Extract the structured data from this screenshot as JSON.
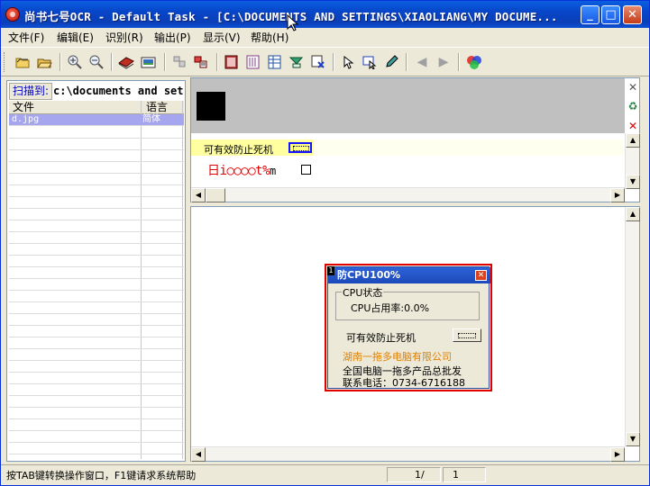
{
  "window": {
    "title": "尚书七号OCR - Default Task - [C:\\DOCUMENTS AND SETTINGS\\XIAOLIANG\\MY DOCUME...",
    "min_glyph": "_",
    "max_glyph": "□",
    "close_glyph": "✕"
  },
  "menu": {
    "items": [
      "文件(F)",
      "编辑(E)",
      "识别(R)",
      "输出(P)",
      "显示(V)",
      "帮助(H)"
    ]
  },
  "toolbar": {
    "icons": [
      "open-folder-icon",
      "open-file-icon",
      "zoom-in-icon",
      "zoom-out-icon",
      "scan-icon",
      "image-icon",
      "layout-icon",
      "select-region-icon",
      "frame-icon",
      "columns-icon",
      "table-icon",
      "auto-region-icon",
      "delete-region-icon",
      "pointer-icon",
      "select-text-icon",
      "pencil-icon",
      "arrow-left-icon",
      "arrow-right-icon",
      "color-icon"
    ]
  },
  "left_panel": {
    "scan_to_label": "扫描到:",
    "scan_path": "c:\\documents and setti",
    "columns": [
      "文件",
      "语言"
    ],
    "rows": [
      {
        "file": "d.jpg",
        "lang": "简体"
      }
    ]
  },
  "recognition": {
    "line1": "可有效防止死机",
    "line2_red": "日i",
    "line2_circles": "○○○○",
    "line2_tail": "t%",
    "line2_m": "m",
    "line2_square": "口"
  },
  "dialog": {
    "marker": "1",
    "title": "防CPU100%",
    "group_label": "CPU状态",
    "cpu_usage": "CPU占用率:0.0%",
    "antifreeze_label": "可有效防止死机",
    "company": "湖南一拖多电脑有限公司",
    "wholesale": "全国电脑一拖多产品总批发",
    "phone": "联系电话：0734-6716188"
  },
  "status": {
    "message": "按TAB键转换操作窗口，F1键请求系统帮助",
    "page_current": "1/",
    "page_total": "1"
  },
  "colors": {
    "title_blue": "#0845c8",
    "selection": "#a6a6ee",
    "dialog_border": "#e00000",
    "company_orange": "#e08000"
  }
}
